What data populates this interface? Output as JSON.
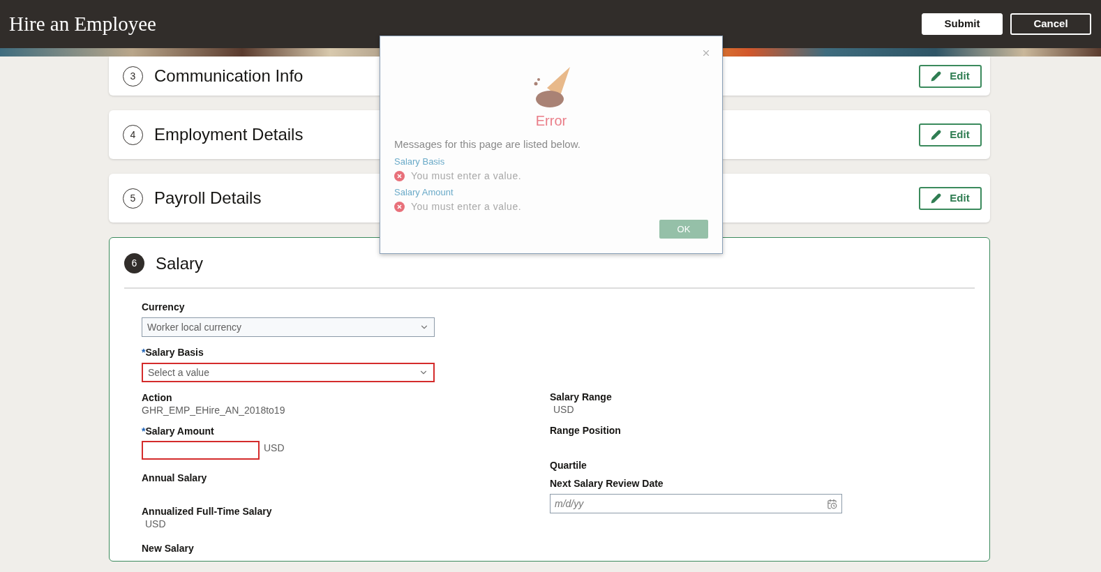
{
  "header": {
    "title": "Hire an Employee",
    "buttons": [
      {
        "label": "Submit",
        "kind": "primary"
      },
      {
        "label": "Cancel",
        "kind": "secondary"
      }
    ]
  },
  "sections": [
    {
      "number": "3",
      "title": "Communication Info",
      "expanded": false,
      "edit_button": "Edit"
    },
    {
      "number": "4",
      "title": "Employment Details",
      "expanded": false,
      "edit_button": "Edit"
    },
    {
      "number": "5",
      "title": "Payroll Details",
      "expanded": false,
      "edit_button": "Edit"
    },
    {
      "number": "6",
      "title": "Salary",
      "expanded": true
    }
  ],
  "salary_form": {
    "left": [
      {
        "kind": "select",
        "label": "Currency",
        "value": "Worker local currency",
        "error": false
      },
      {
        "kind": "select",
        "label": "Salary Basis",
        "placeholder": "Select a value",
        "required_mark": "*",
        "error": true
      },
      {
        "kind": "readonly",
        "label": "Action",
        "value": "GHR_EMP_EHire_AN_2018to19"
      },
      {
        "kind": "amount",
        "label": "Salary Amount",
        "unit": "USD",
        "required_mark": "*",
        "error": true
      },
      {
        "kind": "readonly",
        "label": "Annual Salary"
      },
      {
        "kind": "readonly",
        "label": "Annualized Full-Time Salary",
        "value": "USD"
      },
      {
        "kind": "readonly",
        "label": "New Salary"
      }
    ],
    "right": [
      {
        "kind": "readonly",
        "label": "Salary Range",
        "value": "USD"
      },
      {
        "kind": "readonly",
        "label": "Range Position"
      },
      {
        "kind": "readonly",
        "label": "Quartile"
      },
      {
        "kind": "date",
        "label": "Next Salary Review Date",
        "placeholder": "m/d/yy"
      }
    ]
  },
  "dialog": {
    "title": "Error",
    "intro": "Messages for this page are listed below.",
    "messages": [
      {
        "field": "Salary Basis",
        "text": "You must enter a value."
      },
      {
        "field": "Salary Amount",
        "text": "You must enter a value."
      }
    ],
    "ok_button": "OK"
  }
}
